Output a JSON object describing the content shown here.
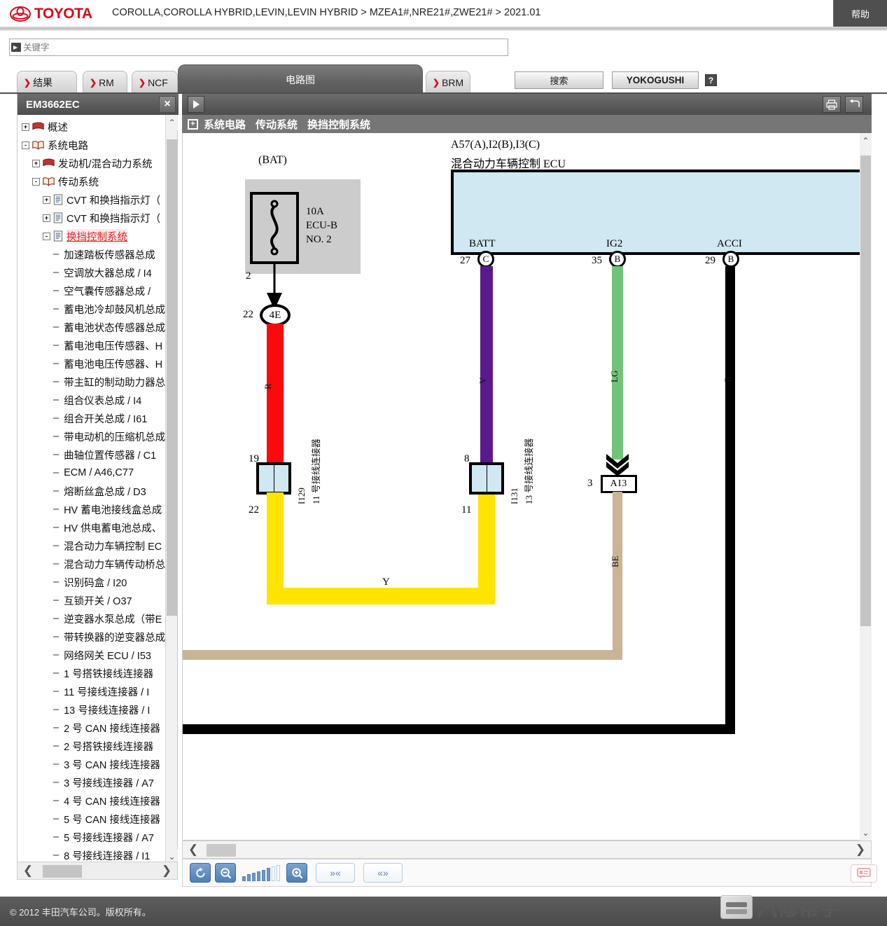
{
  "header": {
    "brand": "TOYOTA",
    "breadcrumb": "COROLLA,COROLLA HYBRID,LEVIN,LEVIN HYBRID > MZEA1#,NRE21#,ZWE21# > 2021.01",
    "help_label": "帮助"
  },
  "search": {
    "placeholder": "关键字",
    "value": "",
    "search_label": "搜索",
    "yokogushi_label": "YOKOGUSHI",
    "help_label": "?"
  },
  "tabs": [
    {
      "label": "结果",
      "active": false
    },
    {
      "label": "RM",
      "active": false
    },
    {
      "label": "NCF",
      "active": false
    },
    {
      "label": "电路图",
      "active": true
    },
    {
      "label": "BRM",
      "active": false
    }
  ],
  "sidebar": {
    "title": "EM3662EC",
    "close_label": "×",
    "tree": [
      {
        "level": 0,
        "toggle": "+",
        "icon": "red-book-icon",
        "label": "概述",
        "selected": false
      },
      {
        "level": 0,
        "toggle": "-",
        "icon": "open-book-icon",
        "label": "系统电路",
        "selected": false
      },
      {
        "level": 1,
        "toggle": "+",
        "icon": "red-book-icon",
        "label": "发动机/混合动力系统",
        "selected": false
      },
      {
        "level": 1,
        "toggle": "-",
        "icon": "open-book-icon",
        "label": "传动系统",
        "selected": false
      },
      {
        "level": 2,
        "toggle": "+",
        "icon": "document-icon",
        "label": "CVT 和换挡指示灯（",
        "selected": false
      },
      {
        "level": 2,
        "toggle": "+",
        "icon": "document-icon",
        "label": "CVT 和换挡指示灯（",
        "selected": false
      },
      {
        "level": 2,
        "toggle": "-",
        "icon": "document-icon",
        "label": "换挡控制系统",
        "selected": true
      },
      {
        "level": 3,
        "toggle": "",
        "icon": "dash",
        "label": "加速踏板传感器总成",
        "selected": false
      },
      {
        "level": 3,
        "toggle": "",
        "icon": "dash",
        "label": "空调放大器总成 / I4",
        "selected": false
      },
      {
        "level": 3,
        "toggle": "",
        "icon": "dash",
        "label": "空气囊传感器总成 /",
        "selected": false
      },
      {
        "level": 3,
        "toggle": "",
        "icon": "dash",
        "label": "蓄电池冷却鼓风机总成",
        "selected": false
      },
      {
        "level": 3,
        "toggle": "",
        "icon": "dash",
        "label": "蓄电池状态传感器总成",
        "selected": false
      },
      {
        "level": 3,
        "toggle": "",
        "icon": "dash",
        "label": "蓄电池电压传感器、H",
        "selected": false
      },
      {
        "level": 3,
        "toggle": "",
        "icon": "dash",
        "label": "蓄电池电压传感器、H",
        "selected": false
      },
      {
        "level": 3,
        "toggle": "",
        "icon": "dash",
        "label": "带主缸的制动助力器总",
        "selected": false
      },
      {
        "level": 3,
        "toggle": "",
        "icon": "dash",
        "label": "组合仪表总成 / I4",
        "selected": false
      },
      {
        "level": 3,
        "toggle": "",
        "icon": "dash",
        "label": "组合开关总成 / I61",
        "selected": false
      },
      {
        "level": 3,
        "toggle": "",
        "icon": "dash",
        "label": "带电动机的压缩机总成",
        "selected": false
      },
      {
        "level": 3,
        "toggle": "",
        "icon": "dash",
        "label": "曲轴位置传感器 / C1",
        "selected": false
      },
      {
        "level": 3,
        "toggle": "",
        "icon": "dash",
        "label": "ECM / A46,C77",
        "selected": false
      },
      {
        "level": 3,
        "toggle": "",
        "icon": "dash",
        "label": "熔断丝盒总成 / D3",
        "selected": false
      },
      {
        "level": 3,
        "toggle": "",
        "icon": "dash",
        "label": "HV 蓄电池接线盒总成",
        "selected": false
      },
      {
        "level": 3,
        "toggle": "",
        "icon": "dash",
        "label": "HV 供电蓄电池总成、",
        "selected": false
      },
      {
        "level": 3,
        "toggle": "",
        "icon": "dash",
        "label": "混合动力车辆控制 EC",
        "selected": false
      },
      {
        "level": 3,
        "toggle": "",
        "icon": "dash",
        "label": "混合动力车辆传动桥总",
        "selected": false
      },
      {
        "level": 3,
        "toggle": "",
        "icon": "dash",
        "label": "识别码盒 / I20",
        "selected": false
      },
      {
        "level": 3,
        "toggle": "",
        "icon": "dash",
        "label": "互锁开关 / O37",
        "selected": false
      },
      {
        "level": 3,
        "toggle": "",
        "icon": "dash",
        "label": "逆变器水泵总成（带E",
        "selected": false
      },
      {
        "level": 3,
        "toggle": "",
        "icon": "dash",
        "label": "带转换器的逆变器总成",
        "selected": false
      },
      {
        "level": 3,
        "toggle": "",
        "icon": "dash",
        "label": "网络网关 ECU / I53",
        "selected": false
      },
      {
        "level": 3,
        "toggle": "",
        "icon": "dash",
        "label": "1 号搭铁接线连接器",
        "selected": false
      },
      {
        "level": 3,
        "toggle": "",
        "icon": "dash",
        "label": "11 号接线连接器 / I",
        "selected": false
      },
      {
        "level": 3,
        "toggle": "",
        "icon": "dash",
        "label": "13 号接线连接器 / I",
        "selected": false
      },
      {
        "level": 3,
        "toggle": "",
        "icon": "dash",
        "label": "2 号 CAN 接线连接器",
        "selected": false
      },
      {
        "level": 3,
        "toggle": "",
        "icon": "dash",
        "label": "2 号搭铁接线连接器",
        "selected": false
      },
      {
        "level": 3,
        "toggle": "",
        "icon": "dash",
        "label": "3 号 CAN 接线连接器",
        "selected": false
      },
      {
        "level": 3,
        "toggle": "",
        "icon": "dash",
        "label": "3 号接线连接器 / A7",
        "selected": false
      },
      {
        "level": 3,
        "toggle": "",
        "icon": "dash",
        "label": "4 号 CAN 接线连接器",
        "selected": false
      },
      {
        "level": 3,
        "toggle": "",
        "icon": "dash",
        "label": "5 号 CAN 接线连接器",
        "selected": false
      },
      {
        "level": 3,
        "toggle": "",
        "icon": "dash",
        "label": "5 号接线连接器 / A7",
        "selected": false
      },
      {
        "level": 3,
        "toggle": "",
        "icon": "dash",
        "label": "8 号接线连接器 / I1",
        "selected": false
      }
    ]
  },
  "diagram_panel": {
    "expand_label": "▶",
    "print_icon": "print-icon",
    "back_icon": "back-icon",
    "breadcrumb_plus": "+",
    "crumb1": "系统电路",
    "crumb2": "传动系统",
    "crumb3": "换挡控制系统"
  },
  "diagram": {
    "bat_label": "(BAT)",
    "fuse_rating": "10A",
    "fuse_name": "ECU-B",
    "fuse_no": "NO. 2",
    "fuse_out_pin": "2",
    "junction_pin_left": "22",
    "junction_label": "4E",
    "ecu_code": "A57(A),I2(B),I3(C)",
    "ecu_name": "混合动力车辆控制 ECU",
    "ecu_terminals": [
      {
        "name": "BATT",
        "pin": "27",
        "conn": "C",
        "wire_color_label": "V",
        "wire_hex": "#5b1a8c"
      },
      {
        "name": "IG2",
        "pin": "35",
        "conn": "B",
        "wire_color_label": "LG",
        "wire_hex": "#72c279"
      },
      {
        "name": "ACCI",
        "pin": "29",
        "conn": "B",
        "wire_color_label": "B",
        "wire_hex": "#000000"
      }
    ],
    "wire_red_label": "R",
    "wire_yellow_label": "Y",
    "wire_be_label": "BE",
    "connector_left": {
      "top_pin": "19",
      "bottom_pin": "22",
      "code": "I129",
      "name": "11 号接线连接器"
    },
    "connector_right": {
      "top_pin": "8",
      "bottom_pin": "11",
      "code": "I131",
      "name": "13 号接线连接器"
    },
    "ai3": {
      "pin": "3",
      "label": "AI3"
    },
    "colors": {
      "red": "#fa0a0a",
      "yellow": "#ffe400",
      "purple": "#5b1a8c",
      "lightgreen": "#72c279",
      "black": "#000000",
      "beige": "#c9b496",
      "ecu_fill": "#cfe8f2",
      "fuse_bg": "#cccccc"
    }
  },
  "zoom_toolbar": {
    "reset_icon": "refresh-icon",
    "zoom_out_icon": "zoom-out-icon",
    "zoom_in_icon": "zoom-in-icon",
    "level": 6,
    "level_max": 8,
    "next_label": "»«",
    "prev_label": "«»",
    "feedback_icon": "feedback-icon"
  },
  "footer": {
    "copyright": "© 2012 丰田汽车公司。版权所有。",
    "watermark": "汽修帮手"
  }
}
